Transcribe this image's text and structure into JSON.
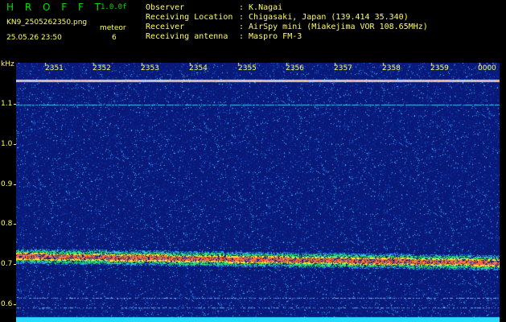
{
  "header": {
    "logo": "H R O F F T",
    "version": "1.0.0f",
    "filename": "KN9_2505262350.png",
    "timestamp": "25.05.26 23:50",
    "meteor_label": "meteor",
    "meteor_count": "6",
    "info": [
      {
        "key": "Observer",
        "value": ": K.Nagai"
      },
      {
        "key": "Receiving Location",
        "value": ": Chigasaki, Japan (139.414 35.340)"
      },
      {
        "key": "Receiver",
        "value": ": AirSpy mini (Miakejima VOR 108.65MHz)"
      },
      {
        "key": "Receiving antenna",
        "value": ": Maspro FM-3"
      }
    ]
  },
  "plot": {
    "unit": "kHz",
    "y_ticks": [
      "1.1",
      "1.0",
      "0.9",
      "0.8",
      "0.7",
      "0.6"
    ],
    "x_ticks": [
      "2351",
      "2352",
      "2353",
      "2354",
      "2355",
      "2356",
      "2357",
      "2358",
      "2359",
      "0000"
    ],
    "colors": {
      "background": "#08197a",
      "text": "#ffff55",
      "logo": "#00e000"
    }
  }
}
